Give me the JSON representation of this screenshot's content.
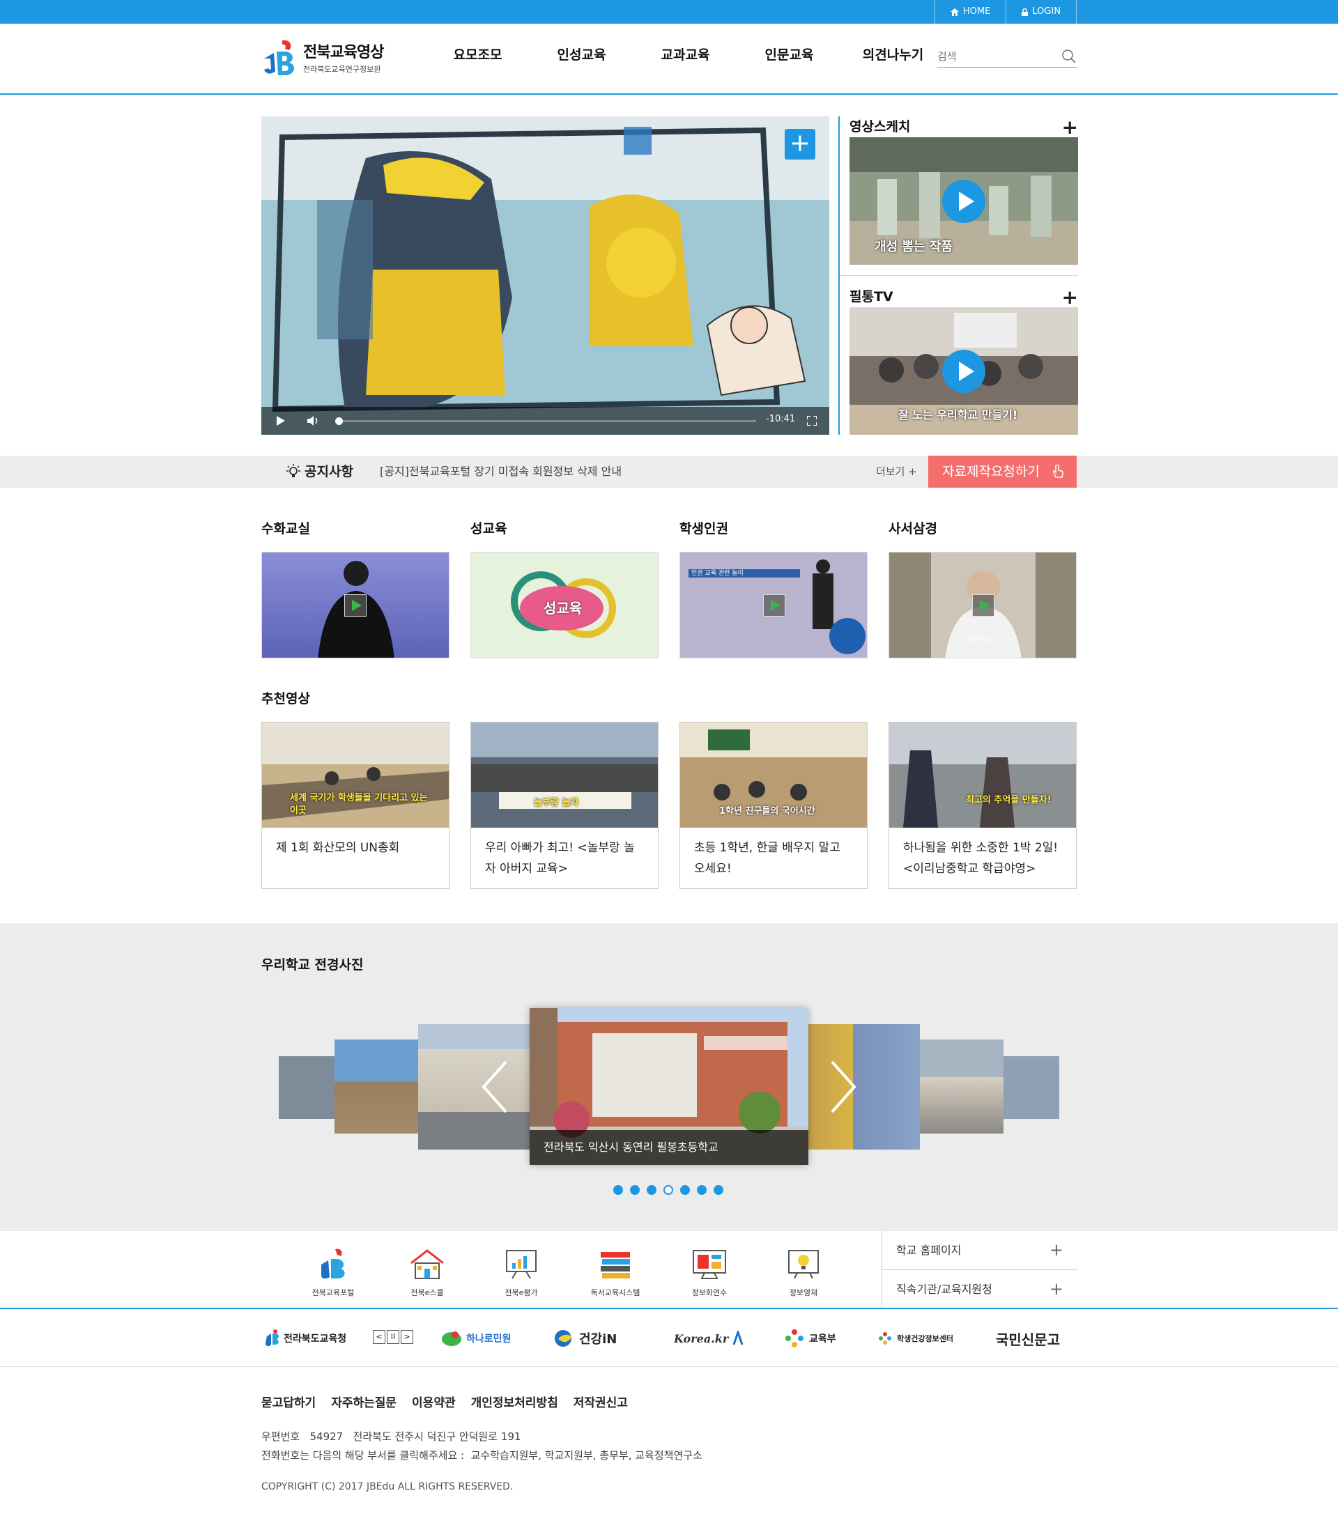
{
  "topbar": {
    "home": "HOME",
    "login": "LOGIN"
  },
  "header": {
    "logo_title": "전북교육영상",
    "logo_sub": "전라북도교육연구정보원",
    "nav": [
      "요모조모",
      "인성교육",
      "교과교육",
      "인문교육",
      "의견나누기"
    ],
    "search_placeholder": "검색"
  },
  "hero": {
    "player_time": "-10:41",
    "side": [
      {
        "title": "영상스케치",
        "caption": "개성 뽐는 작품"
      },
      {
        "title": "필통TV",
        "caption": "잘 노는 우리학교 만들기!"
      }
    ]
  },
  "notice": {
    "label": "공지사항",
    "text": "[공지]전북교육포털 장기 미접속 회원정보 삭제 안내",
    "more": "더보기 +",
    "request": "자료제작요청하기"
  },
  "categories": [
    {
      "title": "수화교실"
    },
    {
      "title": "성교육",
      "overlay": "성교육"
    },
    {
      "title": "학생인권",
      "overlay": "인권 교육 관련 놀이"
    },
    {
      "title": "사서삼경",
      "overlay": "확환석 교수"
    }
  ],
  "recommended": {
    "title": "추천영상",
    "items": [
      {
        "caption": "제 1회 화산모의 UN총회",
        "overlay": "세계 국기가 학생들을 기다리고 있는 이곳"
      },
      {
        "caption": "우리 아빠가 최고! <놀부랑 놀자 아버지 교육>",
        "overlay": "놀부랑 놀자"
      },
      {
        "caption": "초등 1학년, 한글 배우지 말고 오세요!",
        "overlay": "1학년 친구들의 국어시간"
      },
      {
        "caption": "하나됨을 위한 소중한 1박 2일! <이리남중학교 학급야영>",
        "overlay": "최고의 추억을 만들자!"
      }
    ]
  },
  "gallery": {
    "title": "우리학교 전경사진",
    "caption": "전라북도 익산시 동연리 필봉초등학교",
    "dots_total": 7,
    "active_dot": 4
  },
  "quick": {
    "items": [
      "전북교육포털",
      "전북e스쿨",
      "전북e평가",
      "독서교육시스템",
      "정보화연수",
      "정보영재"
    ],
    "right": [
      "학교 홈페이지",
      "직속기관/교육지원청"
    ]
  },
  "partners": [
    "전라북도교육청",
    "하나로민원",
    "건강iN",
    "Korea.kr",
    "교육부",
    "학생건강정보센터",
    "국민신문고"
  ],
  "footer": {
    "links": [
      "묻고답하기",
      "자주하는질문",
      "이용약관",
      "개인정보처리방침",
      "저작권신고"
    ],
    "addr1": "우편번호   54927   전라북도 전주시 덕진구 안덕원로 191",
    "addr2": "전화번호는 다음의 해당 부서를 클릭해주세요 :  교수학습지원부, 학교지원부, 총무부, 교육정책연구소",
    "copyright": "COPYRIGHT (C) 2017 JBEdu ALL RIGHTS RESERVED."
  },
  "colors": {
    "accent": "#1e97e3",
    "request": "#f46e6e",
    "band": "#ececec"
  }
}
